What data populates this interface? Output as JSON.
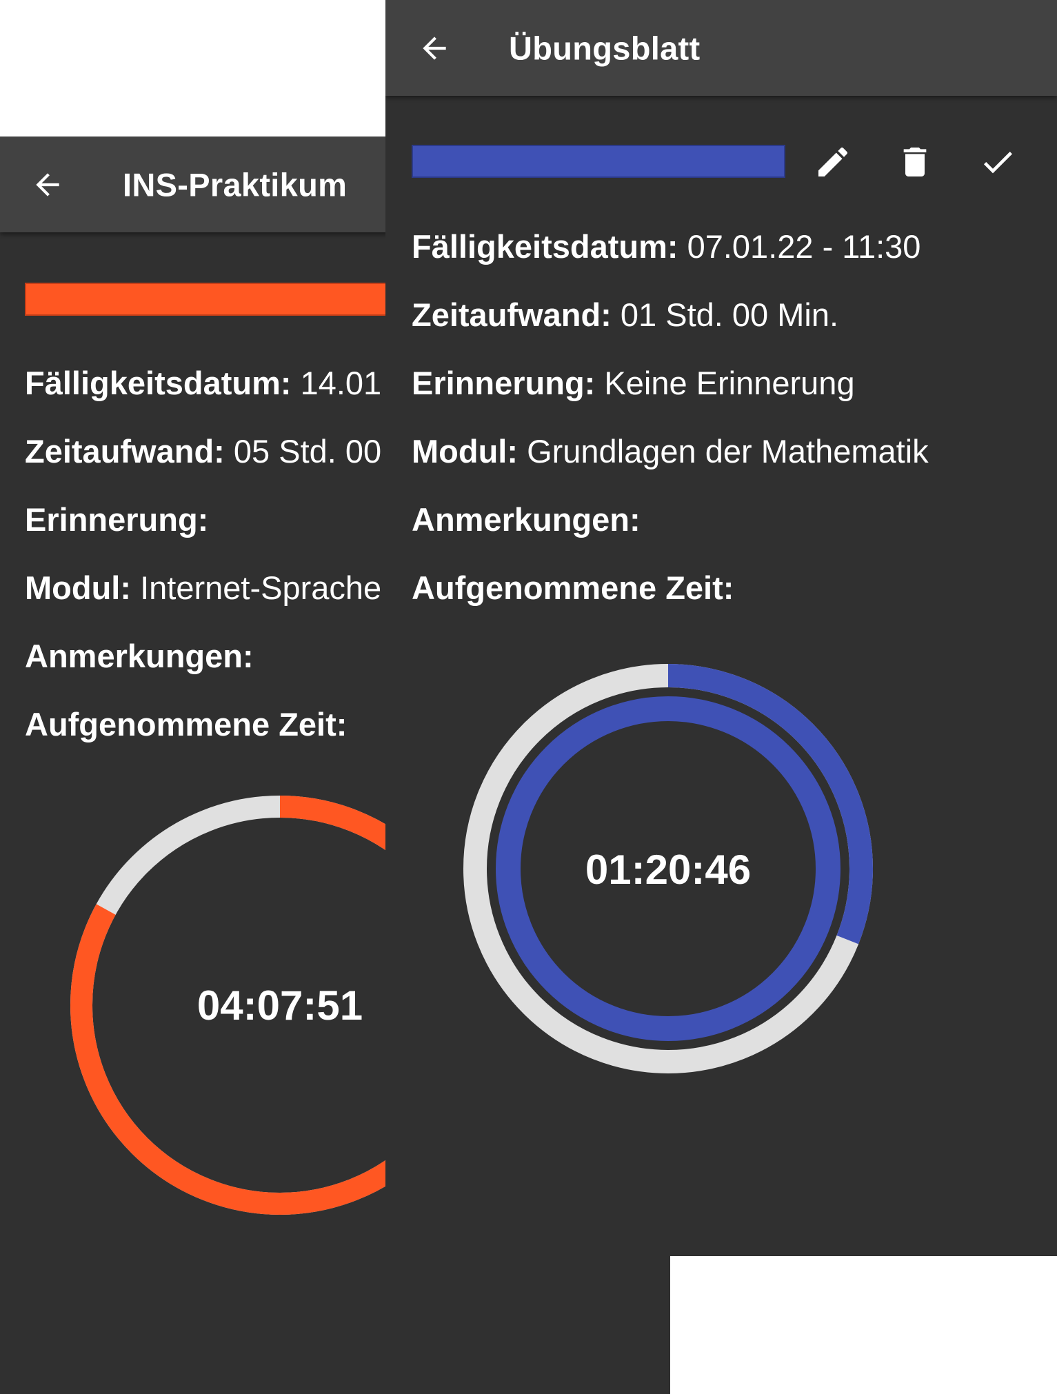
{
  "back_screen": {
    "title": "INS-Praktikum",
    "accent_color": "#ff5722",
    "fields": {
      "due_label": "Fälligkeitsdatum:",
      "due_value": "14.01",
      "effort_label": "Zeitaufwand:",
      "effort_value": "05 Std. 00",
      "reminder_label": "Erinnerung:",
      "reminder_value": "",
      "module_label": "Modul:",
      "module_value": "Internet-Sprache",
      "notes_label": "Anmerkungen:",
      "recorded_label": "Aufgenommene Zeit:"
    },
    "timer": "04:07:51",
    "ring_progress_fraction": 0.83
  },
  "front_screen": {
    "title": "Übungsblatt",
    "accent_color": "#3f51b5",
    "toolbar": {
      "edit_icon": "pencil-icon",
      "delete_icon": "trash-icon",
      "confirm_icon": "check-icon"
    },
    "fields": {
      "due_label": "Fälligkeitsdatum:",
      "due_value": "07.01.22 - 11:30",
      "effort_label": "Zeitaufwand:",
      "effort_value": "01 Std. 00 Min.",
      "reminder_label": "Erinnerung:",
      "reminder_value": "Keine Erinnerung",
      "module_label": "Modul:",
      "module_value": "Grundlagen der Mathematik",
      "notes_label": "Anmerkungen:",
      "recorded_label": "Aufgenommene Zeit:"
    },
    "timer": "01:20:46",
    "outer_ring_progress_fraction": 0.31,
    "inner_ring_progress_fraction": 1.0
  },
  "colors": {
    "background": "#303030",
    "appbar": "#424242",
    "ring_track": "#e0e0e0",
    "text": "#ffffff"
  }
}
